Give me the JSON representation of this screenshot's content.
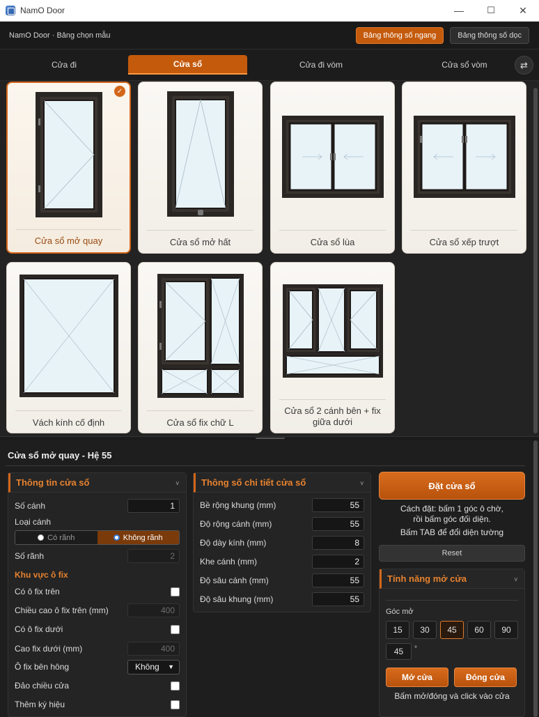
{
  "window": {
    "title": "NamO Door",
    "minimize": "—",
    "maximize": "☐",
    "close": "✕"
  },
  "header": {
    "breadcrumb": "NamO Door · Bảng chọn mẫu",
    "btn_horizontal": "Bảng thông số ngang",
    "btn_vertical": "Bảng thông số dọc"
  },
  "tabs": [
    "Cửa đi",
    "Cửa sổ",
    "Cửa đi vòm",
    "Cửa sổ vòm"
  ],
  "tabs_active": "Cửa sổ",
  "swap_icon": "⇄",
  "cards": [
    {
      "label": "Cửa sổ mở quay",
      "selected": true,
      "check": "✓"
    },
    {
      "label": "Cửa sổ mở hất"
    },
    {
      "label": "Cửa sổ lùa"
    },
    {
      "label": "Cửa sổ xếp trượt"
    },
    {
      "label": "Vách kính cố định"
    },
    {
      "label": "Cửa sổ fix chữ L"
    },
    {
      "label": "Cửa sổ 2 cánh bên + fix giữa dưới"
    }
  ],
  "detail_title": "Cửa sổ mở quay - Hệ 55",
  "info_panel": {
    "title": "Thông tin cửa sổ",
    "chevron": "v",
    "so_canh_label": "Số cánh",
    "so_canh_value": "1",
    "loai_canh_label": "Loại cánh",
    "loai_canh_options": [
      "Có rãnh",
      "Không rãnh"
    ],
    "loai_canh_selected": "Không rãnh",
    "so_ranh_label": "Số rãnh",
    "so_ranh_value": "2",
    "fix_section": "Khu vực ô fix",
    "co_fix_tren": "Có ô fix trên",
    "chieu_cao_fix_tren_label": "Chiều cao ô fix trên (mm)",
    "chieu_cao_fix_tren_value": "400",
    "co_fix_duoi": "Có ô fix dưới",
    "cao_fix_duoi_label": "Cao fix dưới (mm)",
    "cao_fix_duoi_value": "400",
    "fix_ben_hong_label": "Ô fix bên hông",
    "fix_ben_hong_value": "Không",
    "dao_chieu_label": "Đảo chiều cửa",
    "them_ky_hieu_label": "Thêm ký hiệu"
  },
  "detail_panel": {
    "title": "Thông số chi tiết cửa sổ",
    "chevron": "v",
    "rows": [
      {
        "label": "Bề rộng khung (mm)",
        "value": "55"
      },
      {
        "label": "Độ rộng cánh (mm)",
        "value": "55"
      },
      {
        "label": "Độ dày kính (mm)",
        "value": "8"
      },
      {
        "label": "Khe cánh (mm)",
        "value": "2"
      },
      {
        "label": "Độ sâu cánh (mm)",
        "value": "55"
      },
      {
        "label": "Độ sâu khung (mm)",
        "value": "55"
      }
    ]
  },
  "actions": {
    "place_label": "Đặt cửa sổ",
    "hint_line1": "Cách đặt: bấm 1 góc ô chờ,",
    "hint_line2": "rồi bấm góc đối diện.",
    "hint_line3": "Bấm TAB để đổi diện tường",
    "reset_label": "Reset"
  },
  "open_panel": {
    "title": "Tính năng mở cửa",
    "chevron": "v",
    "angle_label": "Góc mở",
    "angles": [
      "15",
      "30",
      "45",
      "60",
      "90"
    ],
    "angle_selected": "45",
    "angle_value": "45",
    "degree": "°",
    "open_btn": "Mở cửa",
    "close_btn": "Đóng cửa",
    "footer_hint": "Bấm mở/đóng và click vào cửa"
  },
  "colors": {
    "accent": "#d2661a",
    "accent_text": "#e7822f",
    "bg": "#1e1e1e"
  }
}
